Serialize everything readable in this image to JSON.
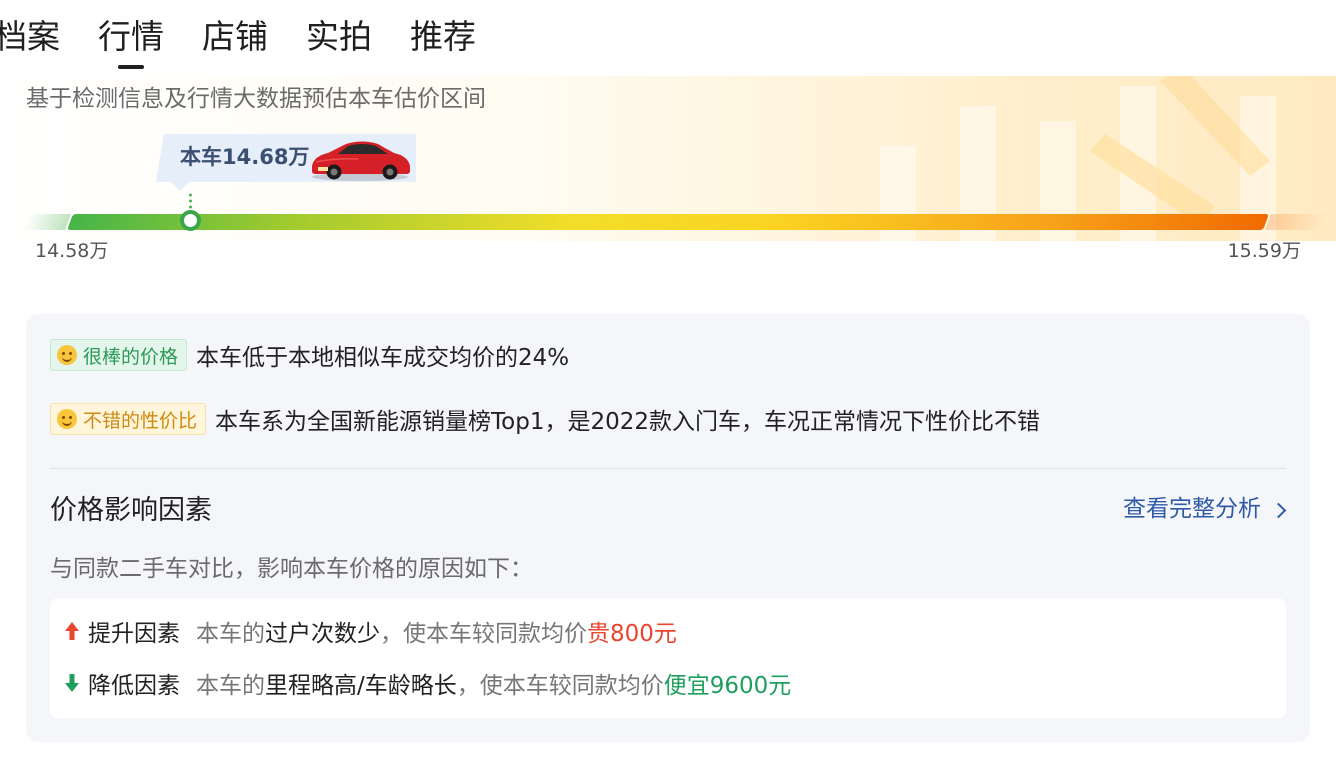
{
  "tabs": [
    {
      "label": "档案",
      "active": false
    },
    {
      "label": "行情",
      "active": true
    },
    {
      "label": "店铺",
      "active": false
    },
    {
      "label": "实拍",
      "active": false
    },
    {
      "label": "推荐",
      "active": false
    }
  ],
  "estimate": {
    "note": "基于检测信息及行情大数据预估本车估价区间",
    "current_price_label": "本车14.68万",
    "range_min": "14.58万",
    "range_max": "15.59万",
    "marker_fraction": 0.1,
    "bar_colors": [
      "#46b549",
      "#f2de2a",
      "#f26a00"
    ]
  },
  "verdicts": [
    {
      "badge": "很棒的价格",
      "text": "本车低于本地相似车成交均价的24%"
    },
    {
      "badge": "不错的性价比",
      "text": "本车系为全国新能源销量榜Top1，是2022款入门车，车况正常情况下性价比不错"
    }
  ],
  "factors": {
    "title": "价格影响因素",
    "link_label": "查看完整分析",
    "subtitle": "与同款二手车对比，影响本车价格的原因如下：",
    "items": [
      {
        "label": "提升因素",
        "prefix": "本车的",
        "reason": "过户次数少",
        "middle": "，使本车较同款均价",
        "effect": "贵800元",
        "direction": "up",
        "color": "#e8462f"
      },
      {
        "label": "降低因素",
        "prefix": "本车的",
        "reason": "里程略高/车龄略长",
        "middle": "，使本车较同款均价",
        "effect": "便宜9600元",
        "direction": "down",
        "color": "#1f9f5e"
      }
    ]
  }
}
